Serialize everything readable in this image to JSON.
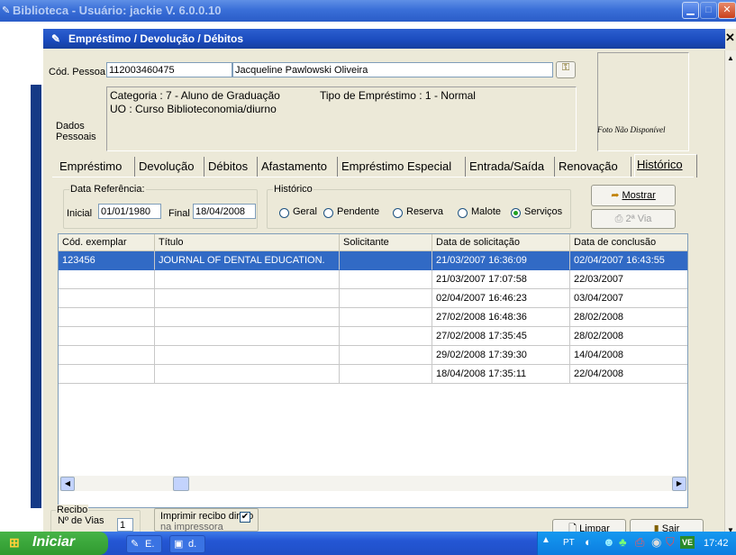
{
  "app": {
    "title": "Biblioteca - Usuário: jackie   V. 6.0.0.10"
  },
  "dialog": {
    "title": "Empréstimo / Devolução / Débitos"
  },
  "person": {
    "code_label": "Cód. Pessoa",
    "code_value": "112003460475",
    "name_value": "Jacqueline Pawlowski Oliveira",
    "section_label_1": "Dados",
    "section_label_2": "Pessoais",
    "category": "Categoria : 7 - Aluno de Graduação",
    "loan_type": "Tipo de Empréstimo : 1 - Normal",
    "uo": "UO : Curso Biblioteconomia/diurno",
    "photo_text": "Foto Não Disponível"
  },
  "tabs": [
    {
      "label": "Empréstimo"
    },
    {
      "label": "Devolução"
    },
    {
      "label": "Débitos"
    },
    {
      "label": "Afastamento"
    },
    {
      "label": "Empréstimo Especial"
    },
    {
      "label": "Entrada/Saída"
    },
    {
      "label": "Renovação"
    },
    {
      "label": "Histórico"
    }
  ],
  "filters": {
    "date_group_label": "Data Referência:",
    "initial_label": "Inicial",
    "initial_value": "01/01/1980",
    "final_label": "Final",
    "final_value": "18/04/2008",
    "history_group_label": "Histórico",
    "options": [
      "Geral",
      "Pendente",
      "Reserva",
      "Malote",
      "Serviços"
    ],
    "selected_option": "Serviços"
  },
  "buttons": {
    "show": "Mostrar",
    "second_copy": "2ª Via",
    "clear": "Limpar",
    "exit": "Sair"
  },
  "table": {
    "columns": [
      "Cód. exemplar",
      "Título",
      "Solicitante",
      "Data de solicitação",
      "Data de conclusão"
    ],
    "rows": [
      [
        "123456",
        "JOURNAL  OF DENTAL EDUCATION.",
        "",
        "21/03/2007 16:36:09",
        "02/04/2007 16:43:55"
      ],
      [
        "",
        "",
        "",
        "21/03/2007 17:07:58",
        "22/03/2007"
      ],
      [
        "",
        "",
        "",
        "02/04/2007 16:46:23",
        "03/04/2007"
      ],
      [
        "",
        "",
        "",
        "27/02/2008 16:48:36",
        "28/02/2008"
      ],
      [
        "",
        "",
        "",
        "27/02/2008 17:35:45",
        "28/02/2008"
      ],
      [
        "",
        "",
        "",
        "29/02/2008 17:39:30",
        "14/04/2008"
      ],
      [
        "",
        "",
        "",
        "18/04/2008 17:35:11",
        "22/04/2008"
      ]
    ]
  },
  "receipt": {
    "group_label": "Recibo",
    "copies_label": "Nº de Vias",
    "copies_value": "1",
    "print_label": "Imprimir recibo direto",
    "print_label_2": "na impressora"
  },
  "taskbar": {
    "start": "Iniciar",
    "items": [
      "E.",
      "d."
    ],
    "lang": "PT",
    "clock": "17:42"
  }
}
